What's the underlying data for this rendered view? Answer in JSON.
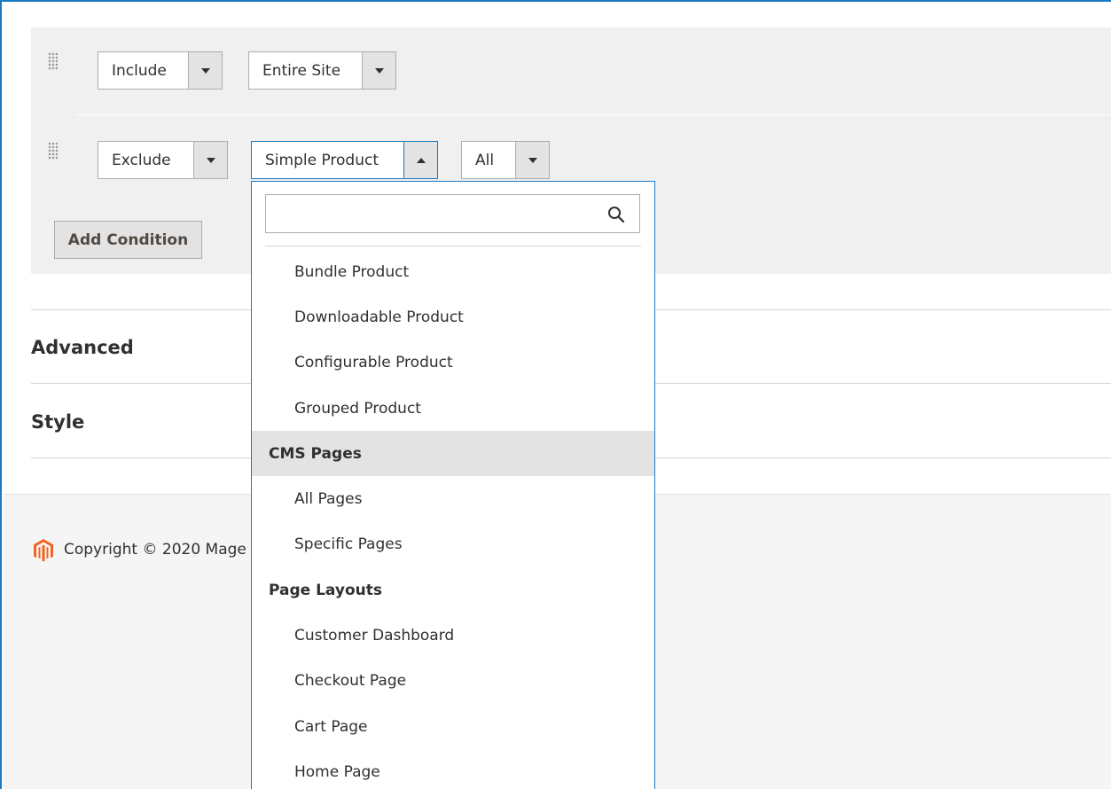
{
  "conditions": [
    {
      "operator": "Include",
      "scope": "Entire Site"
    },
    {
      "operator": "Exclude",
      "scope": "Simple Product",
      "value": "All"
    }
  ],
  "add_condition_label": "Add Condition",
  "sections": {
    "advanced": "Advanced",
    "style": "Style"
  },
  "footer": {
    "copyright": "Copyright © 2020 Mage"
  },
  "dropdown": {
    "search_value": "",
    "items": [
      {
        "label": "Bundle Product",
        "kind": "child"
      },
      {
        "label": "Downloadable Product",
        "kind": "child"
      },
      {
        "label": "Configurable Product",
        "kind": "child"
      },
      {
        "label": "Grouped Product",
        "kind": "child"
      },
      {
        "label": "CMS Pages",
        "kind": "group",
        "highlighted": true
      },
      {
        "label": "All Pages",
        "kind": "child"
      },
      {
        "label": "Specific Pages",
        "kind": "child"
      },
      {
        "label": "Page Layouts",
        "kind": "group"
      },
      {
        "label": "Customer Dashboard",
        "kind": "child"
      },
      {
        "label": "Checkout Page",
        "kind": "child"
      },
      {
        "label": "Cart Page",
        "kind": "child"
      },
      {
        "label": "Home Page",
        "kind": "child"
      }
    ]
  },
  "colors": {
    "accent": "#1979c3",
    "panel": "#f0f0f0",
    "magento_logo": "#f26322"
  }
}
